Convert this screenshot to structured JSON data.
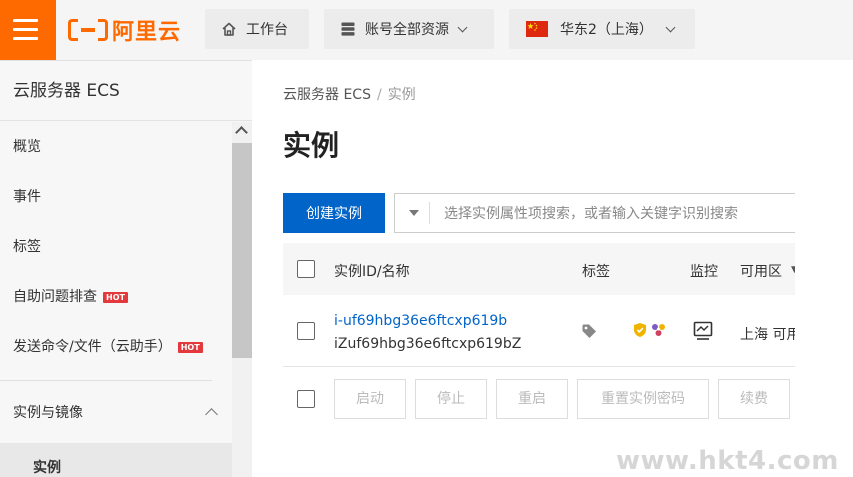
{
  "header": {
    "logo_text": "阿里云",
    "workbench_label": "工作台",
    "resources_label": "账号全部资源",
    "region_label": "华东2（上海）"
  },
  "sidebar": {
    "title": "云服务器 ECS",
    "items": [
      {
        "label": "概览"
      },
      {
        "label": "事件"
      },
      {
        "label": "标签"
      },
      {
        "label": "自助问题排查",
        "badge": "HOT"
      },
      {
        "label": "发送命令/文件（云助手）",
        "badge": "HOT"
      }
    ],
    "group_label": "实例与镜像",
    "sub_item": "实例"
  },
  "main": {
    "breadcrumb": [
      "云服务器 ECS",
      "实例"
    ],
    "title": "实例",
    "create_button": "创建实例",
    "search_placeholder": "选择实例属性项搜索，或者输入关键字识别搜索",
    "columns": [
      "实例ID/名称",
      "标签",
      "监控",
      "可用区"
    ],
    "row": {
      "id": "i-uf69hbg36e6ftcxp619b",
      "name": "iZuf69hbg36e6ftcxp619bZ",
      "zone": "上海 可用"
    },
    "actions": [
      "启动",
      "停止",
      "重启",
      "重置实例密码",
      "续费"
    ]
  },
  "watermark": "www.hkt4.com",
  "colors": {
    "brand": "#ff6a00",
    "primary": "#0064c8",
    "hot": "#e4393c"
  }
}
